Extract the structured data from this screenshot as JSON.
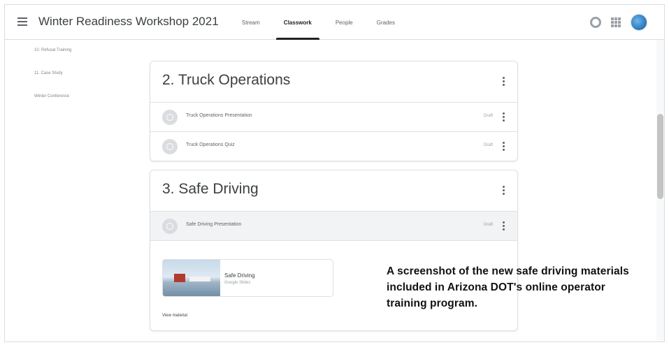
{
  "header": {
    "title": "Winter Readiness Workshop 2021",
    "tabs": [
      {
        "label": "Stream",
        "active": false
      },
      {
        "label": "Classwork",
        "active": true
      },
      {
        "label": "People",
        "active": false
      },
      {
        "label": "Grades",
        "active": false
      }
    ],
    "icons": [
      "menu-icon",
      "gear-icon",
      "apps-icon",
      "avatar"
    ]
  },
  "sidebar": {
    "items": [
      {
        "label": "10. Refusal Training"
      },
      {
        "label": "11. Case Study"
      },
      {
        "label": "Winter Conference"
      }
    ]
  },
  "topics": [
    {
      "title": "2. Truck Operations",
      "materials": [
        {
          "label": "Truck Operations Presentation",
          "meta": "Draft"
        },
        {
          "label": "Truck Operations Quiz",
          "meta": "Draft"
        }
      ]
    },
    {
      "title": "3. Safe Driving",
      "materials": [
        {
          "label": "Safe Driving Presentation",
          "meta": "Draft"
        }
      ],
      "expanded": {
        "attachment_title": "Safe Driving",
        "attachment_subtitle": "Google Slides",
        "view_link": "View material"
      }
    }
  ],
  "caption": "A screenshot of the new safe driving materials included in Arizona DOT's online operator training program.",
  "colors": {
    "accent": "#202124",
    "border": "#dadce0",
    "caption": "#111111"
  }
}
